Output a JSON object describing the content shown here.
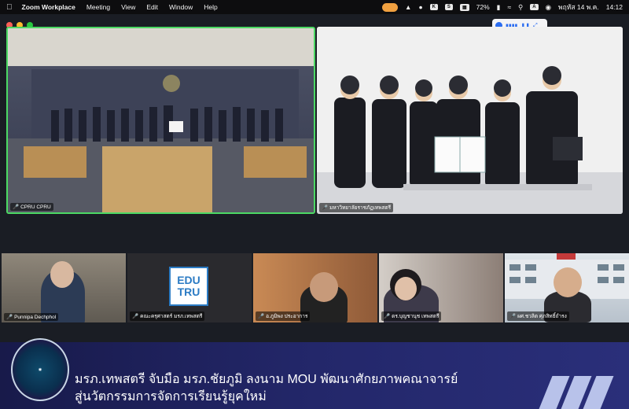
{
  "menubar": {
    "app_name": "Zoom Workplace",
    "items": [
      "Meeting",
      "View",
      "Edit",
      "Window",
      "Help"
    ],
    "battery": "72%",
    "date": "พฤหัส 14 พ.ค.",
    "time": "14:12"
  },
  "colors": {
    "active_speaker_border": "#4cd964",
    "banner_background": "#23276a",
    "mic_muted": "#e84a4a"
  },
  "participants": {
    "main_left": "CPRU CPRU",
    "main_right": "มหาวิทยาลัยราชภัฏเทพสตรี",
    "thumbs": [
      "Punnipa Dechphol",
      "คณะครุศาสตร์ มรภ.เทพสตรี",
      "อ.ภูมิพง ประอาการ",
      "ดร.บุญชานุช เทพสตรี",
      "ผศ.ชวลิต ศุภสิทธิ์ถำรง"
    ]
  },
  "thumb_logo": {
    "line1": "EDU",
    "line2": "TRU"
  },
  "banner": {
    "line1": "มรภ.เทพสตรี จับมือ มรภ.ชัยภูมิ ลงนาม MOU พัฒนาศักยภาพคณาจารย์",
    "line2": "สู่นวัตกรรมการจัดการเรียนรู้ยุคใหม่"
  }
}
